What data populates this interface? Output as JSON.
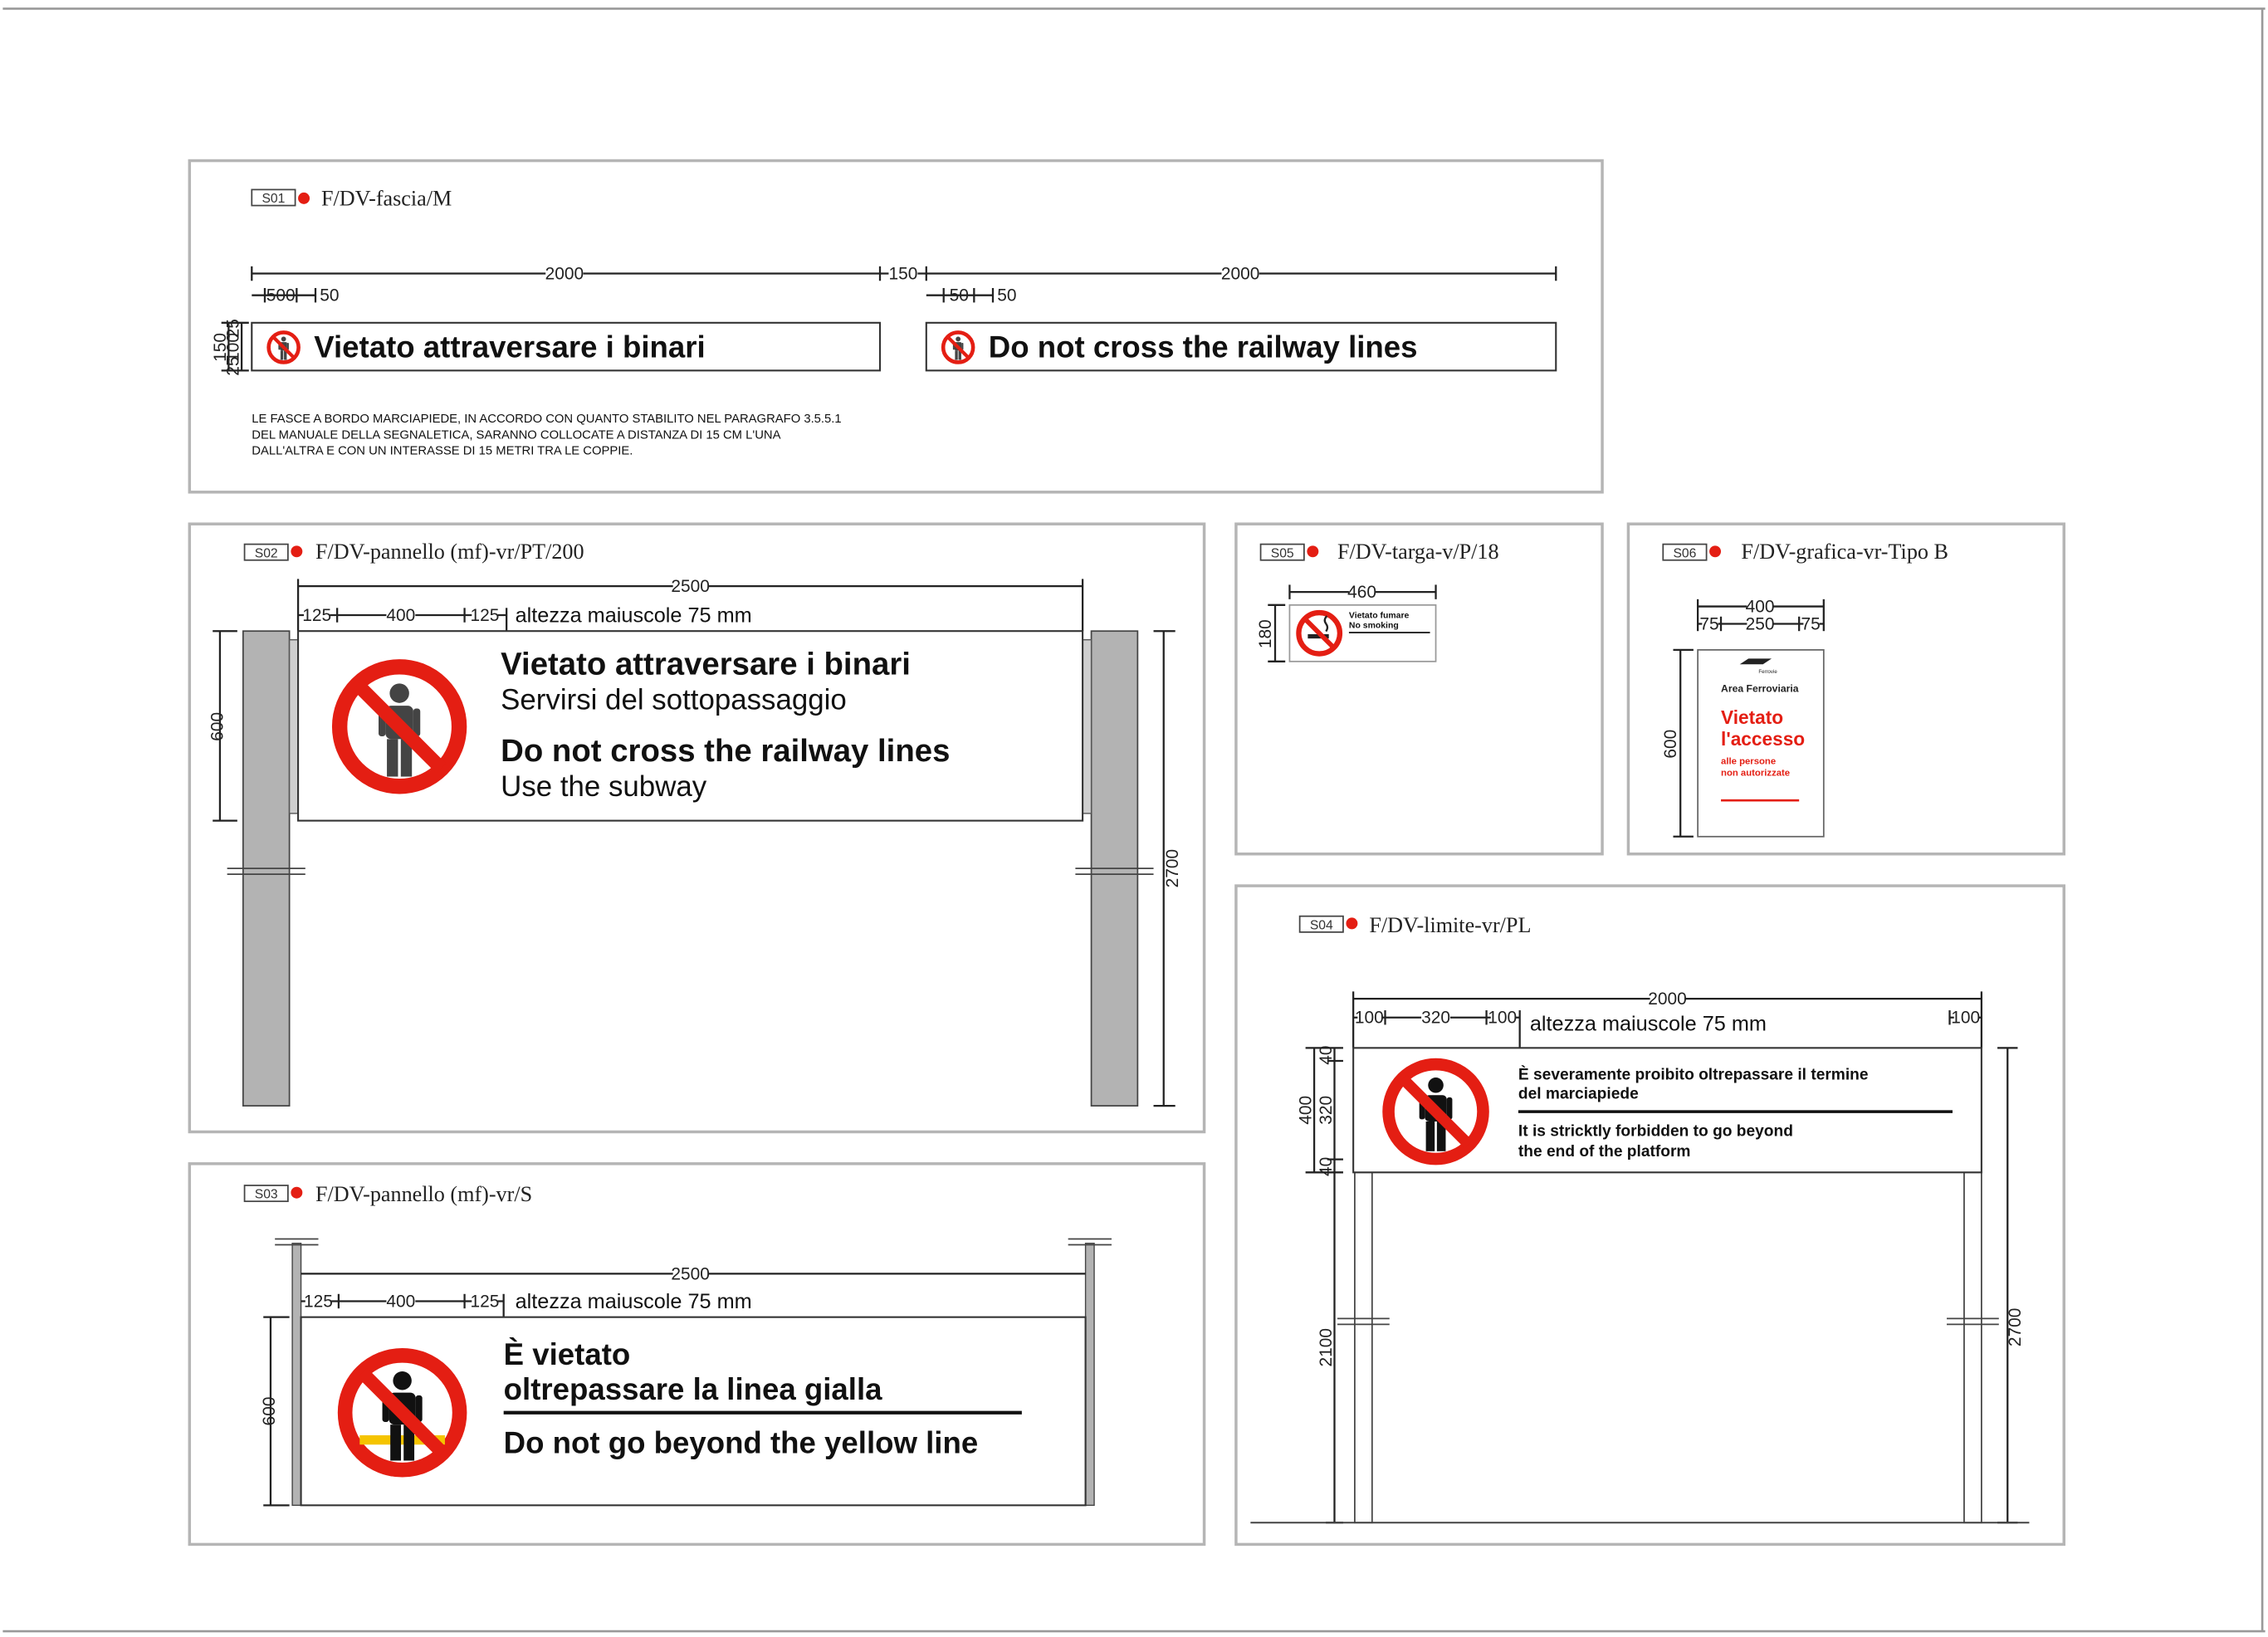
{
  "colors": {
    "accent_red": "#e41e13",
    "post_gray": "#b3b3b3",
    "yellow_line": "#f5c400",
    "pictogram": "#222222"
  },
  "icons": [
    "no-pedestrian-crossing-icon",
    "no-smoking-icon",
    "fs-logo-icon",
    "dot-marker-icon"
  ],
  "panels": {
    "s01": {
      "code": "S01",
      "title": "F/DV-fascia/M",
      "dims": {
        "w1": "2000",
        "gap": "150",
        "w2": "2000",
        "d500": "500",
        "d50a": "50",
        "d50b": "50",
        "d50c": "50",
        "h150": "150",
        "h25a": "25",
        "h100": "100",
        "h25b": "25"
      },
      "strip_it": "Vietato attraversare i binari",
      "strip_en": "Do not cross the railway lines",
      "note": [
        "LE FASCE A BORDO MARCIAPIEDE, IN ACCORDO CON QUANTO STABILITO NEL PARAGRAFO 3.5.5.1",
        "DEL MANUALE DELLA SEGNALETICA, SARANNO COLLOCATE A DISTANZA DI 15 CM L'UNA",
        "DALL'ALTRA E CON UN INTERASSE DI 15 METRI  TRA LE COPPIE."
      ]
    },
    "s02": {
      "code": "S02",
      "title": "F/DV-pannello (mf)-vr/PT/200",
      "dims": {
        "w": "2500",
        "d125a": "125",
        "d400": "400",
        "d125b": "125",
        "h600": "600",
        "h2700": "2700"
      },
      "caps_note": "altezza maiuscole 75 mm",
      "line1": "Vietato attraversare i binari",
      "line2": "Servirsi del sottopassaggio",
      "line3": "Do not cross the railway lines",
      "line4": "Use the subway"
    },
    "s03": {
      "code": "S03",
      "title": "F/DV-pannello (mf)-vr/S",
      "dims": {
        "w": "2500",
        "d125a": "125",
        "d400": "400",
        "d125b": "125",
        "h600": "600"
      },
      "caps_note": "altezza maiuscole 75 mm",
      "line1": "È vietato",
      "line2": "oltrepassare la linea gialla",
      "line3": "Do not go beyond the yellow line"
    },
    "s04": {
      "code": "S04",
      "title": "F/DV-limite-vr/PL",
      "dims": {
        "w": "2000",
        "d100a": "100",
        "d320": "320",
        "d100b": "100",
        "d100c": "100",
        "h400": "400",
        "h40a": "40",
        "h320": "320",
        "h40b": "40",
        "h2100": "2100",
        "h2700": "2700"
      },
      "caps_note": "altezza maiuscole 75 mm",
      "it_1": "È severamente proibito oltrepassare il termine",
      "it_2": "del marciapiede",
      "en_1": "It is stricktly forbidden to go beyond",
      "en_2": "the end of the platform"
    },
    "s05": {
      "code": "S05",
      "title": "F/DV-targa-v/P/18",
      "dims": {
        "w": "460",
        "h": "180"
      },
      "line1": "Vietato fumare",
      "line2": "No smoking"
    },
    "s06": {
      "code": "S06",
      "title": "F/DV-grafica-vr-Tipo B",
      "dims": {
        "w": "400",
        "d75a": "75",
        "d250": "250",
        "d75b": "75",
        "h600": "600"
      },
      "logo_word": "Ferrovie",
      "area": "Area Ferroviaria",
      "big1": "Vietato",
      "big2": "l'accesso",
      "small1": "alle persone",
      "small2": "non autorizzate"
    }
  }
}
